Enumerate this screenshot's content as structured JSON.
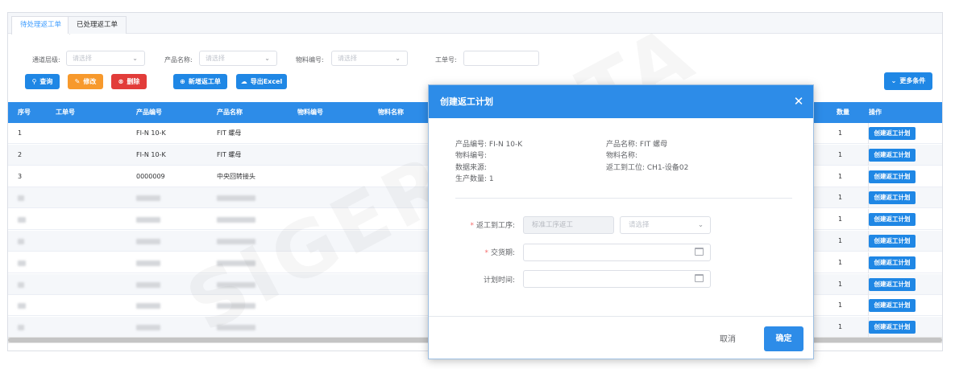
{
  "tabs": [
    {
      "label": "待处理返工单",
      "active": true
    },
    {
      "label": "已处理返工单",
      "active": false
    }
  ],
  "filters": {
    "channel_label": "通道层级:",
    "channel_placeholder": "请选择",
    "product_name_label": "产品名称:",
    "product_name_placeholder": "请选择",
    "material_code_label": "物料编号:",
    "material_code_placeholder": "请选择",
    "work_order_label": "工单号:",
    "work_order_value": ""
  },
  "toolbar": {
    "query": "查询",
    "edit": "修改",
    "delete": "删除",
    "add_rework": "新增返工单",
    "export_excel": "导出Excel",
    "more_conditions": "更多条件"
  },
  "table": {
    "headers": {
      "seq": "序号",
      "work_order": "工单号",
      "product_code": "产品编号",
      "product_name": "产品名称",
      "material_code": "物料编号",
      "material_name": "物料名称",
      "quantity": "数量",
      "action": "操作"
    },
    "rows": [
      {
        "seq": "1",
        "product_code": "FI-N 10-K",
        "product_name": "FIT 螺母",
        "quantity": "1",
        "action": "创建返工计划"
      },
      {
        "seq": "2",
        "product_code": "FI-N 10-K",
        "product_name": "FIT 螺母",
        "quantity": "1",
        "action": "创建返工计划"
      },
      {
        "seq": "3",
        "product_code": "0000009",
        "product_name": "中央回转接头",
        "quantity": "1",
        "action": "创建返工计划"
      },
      {
        "seq": "",
        "product_code": "",
        "product_name": "",
        "quantity": "1",
        "action": "创建返工计划"
      },
      {
        "seq": "",
        "product_code": "",
        "product_name": "",
        "quantity": "1",
        "action": "创建返工计划"
      },
      {
        "seq": "",
        "product_code": "",
        "product_name": "",
        "quantity": "1",
        "action": "创建返工计划"
      },
      {
        "seq": "",
        "product_code": "",
        "product_name": "",
        "quantity": "1",
        "action": "创建返工计划"
      },
      {
        "seq": "",
        "product_code": "",
        "product_name": "",
        "quantity": "1",
        "action": "创建返工计划"
      },
      {
        "seq": "",
        "product_code": "",
        "product_name": "",
        "quantity": "1",
        "action": "创建返工计划"
      },
      {
        "seq": "",
        "product_code": "",
        "product_name": "",
        "quantity": "1",
        "action": "创建返工计划"
      }
    ]
  },
  "watermark": "SIGER DATA",
  "dialog": {
    "title": "创建返工计划",
    "info": {
      "product_code": "产品编号: FI-N 10-K",
      "product_name": "产品名称: FIT 螺母",
      "material_code": "物料编号:",
      "material_name": "物料名称:",
      "data_source": "数据来源:",
      "return_station": "返工到工位: CH1-设备02",
      "production_qty": "生产数量: 1"
    },
    "form": {
      "return_process_label": "返工到工序:",
      "return_process_value": "标准工序返工",
      "return_process_select_placeholder": "请选择",
      "delivery_label": "交货期:",
      "plan_time_label": "计划时间:"
    },
    "cancel": "取消",
    "confirm": "确定"
  },
  "colors": {
    "primary": "#2d8ce8",
    "orange": "#f7992c",
    "red": "#e23c39"
  }
}
